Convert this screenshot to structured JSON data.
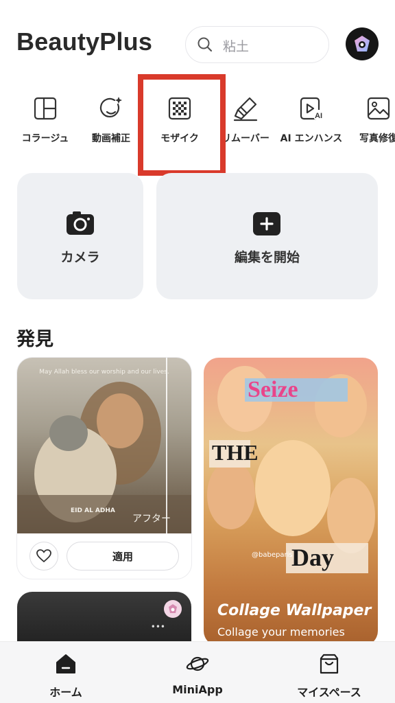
{
  "header": {
    "app_title": "BeautyPlus",
    "search_placeholder": "粘土"
  },
  "tools": [
    {
      "label": "コラージュ",
      "icon": "collage-icon"
    },
    {
      "label": "動画補正",
      "icon": "face-retouch-icon"
    },
    {
      "label": "モザイク",
      "icon": "mosaic-icon"
    },
    {
      "label": "リムーバー",
      "icon": "eraser-icon"
    },
    {
      "label": "AI エンハンス",
      "icon": "ai-enhance-icon"
    },
    {
      "label": "写真修復",
      "icon": "photo-repair-icon"
    }
  ],
  "actions": {
    "camera_label": "カメラ",
    "edit_label": "編集を開始"
  },
  "discover": {
    "title": "発見",
    "card1": {
      "caption": "May Allah bless our worship and our lives.",
      "eid_text": "EID AL ADHA",
      "after_label": "アフター",
      "apply_label": "適用"
    },
    "card2": {
      "title": "Collage Wallpaper",
      "subtitle": "Collage your memories",
      "collage_words": [
        "Seize",
        "THE",
        "Day"
      ],
      "watermark": "@babeparis"
    }
  },
  "bottom_nav": {
    "home": "ホーム",
    "miniapp": "MiniApp",
    "myspace": "マイスペース"
  },
  "colors": {
    "highlight": "#d93a2b",
    "card_bg": "#eef0f3",
    "text": "#1f1f1f"
  }
}
